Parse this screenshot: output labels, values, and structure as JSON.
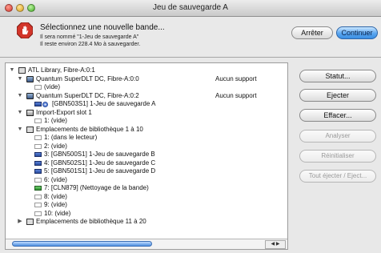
{
  "window": {
    "title": "Jeu de sauvegarde A"
  },
  "header": {
    "message": "Sélectionnez une nouvelle bande...",
    "line1": "Il sera nommé \"1-Jeu de sauvegarde A\"",
    "line2": "Il reste environ 228.4 Mo à sauvegarder.",
    "icon": "stop-hand-icon"
  },
  "buttons": {
    "stop": "Arrêter",
    "continue": "Continuer"
  },
  "tree": [
    {
      "indent": 0,
      "tri": "▼",
      "icon": "library",
      "label": "ATL Library, Fibre-A:0:1",
      "support": ""
    },
    {
      "indent": 1,
      "tri": "▼",
      "icon": "drive",
      "label": "Quantum SuperDLT DC, Fibre-A:0:0",
      "support": "Aucun support"
    },
    {
      "indent": 2,
      "tri": "",
      "icon": "tape-empty",
      "label": "(vide)",
      "support": ""
    },
    {
      "indent": 1,
      "tri": "▼",
      "icon": "drive",
      "label": "Quantum SuperDLT DC, Fibre-A:0:2",
      "support": "Aucun support"
    },
    {
      "indent": 2,
      "tri": "",
      "icon": "tape+disc",
      "label": "[GBN503S1] 1-Jeu de sauvegarde A",
      "support": ""
    },
    {
      "indent": 1,
      "tri": "▼",
      "icon": "io",
      "label": "Import-Export slot 1",
      "support": ""
    },
    {
      "indent": 2,
      "tri": "",
      "icon": "tape-empty",
      "label": "1: (vide)",
      "support": ""
    },
    {
      "indent": 1,
      "tri": "▼",
      "icon": "library",
      "label": "Emplacements de bibliothèque 1 à 10",
      "support": ""
    },
    {
      "indent": 2,
      "tri": "",
      "icon": "tape-empty",
      "label": "1: (dans le lecteur)",
      "support": ""
    },
    {
      "indent": 2,
      "tri": "",
      "icon": "tape-empty",
      "label": "2: (vide)",
      "support": ""
    },
    {
      "indent": 2,
      "tri": "",
      "icon": "tape",
      "label": "3: [GBN500S1] 1-Jeu de sauvegarde B",
      "support": ""
    },
    {
      "indent": 2,
      "tri": "",
      "icon": "tape",
      "label": "4: [GBN502S1] 1-Jeu de sauvegarde C",
      "support": ""
    },
    {
      "indent": 2,
      "tri": "",
      "icon": "tape",
      "label": "5: [GBN501S1] 1-Jeu de sauvegarde D",
      "support": ""
    },
    {
      "indent": 2,
      "tri": "",
      "icon": "tape-empty",
      "label": "6: (vide)",
      "support": ""
    },
    {
      "indent": 2,
      "tri": "",
      "icon": "tape-clean",
      "label": "7: [CLN879] (Nettoyage de la bande)",
      "support": ""
    },
    {
      "indent": 2,
      "tri": "",
      "icon": "tape-empty",
      "label": "8: (vide)",
      "support": ""
    },
    {
      "indent": 2,
      "tri": "",
      "icon": "tape-empty",
      "label": "9: (vide)",
      "support": ""
    },
    {
      "indent": 2,
      "tri": "",
      "icon": "tape-empty",
      "label": "10: (vide)",
      "support": ""
    },
    {
      "indent": 1,
      "tri": "▶",
      "icon": "library",
      "label": "Emplacements de bibliothèque 11 à 20",
      "support": ""
    }
  ],
  "side_buttons": [
    {
      "label": "Statut...",
      "enabled": true
    },
    {
      "label": "Ejecter",
      "enabled": true
    },
    {
      "label": "Effacer...",
      "enabled": true
    },
    {
      "label": "Analyser",
      "enabled": false
    },
    {
      "label": "Réinitialiser",
      "enabled": false
    },
    {
      "label": "Tout éjecter / Eject...",
      "enabled": false
    }
  ],
  "colors": {
    "accent": "#3a8ee4",
    "stop_red": "#d2352a"
  }
}
